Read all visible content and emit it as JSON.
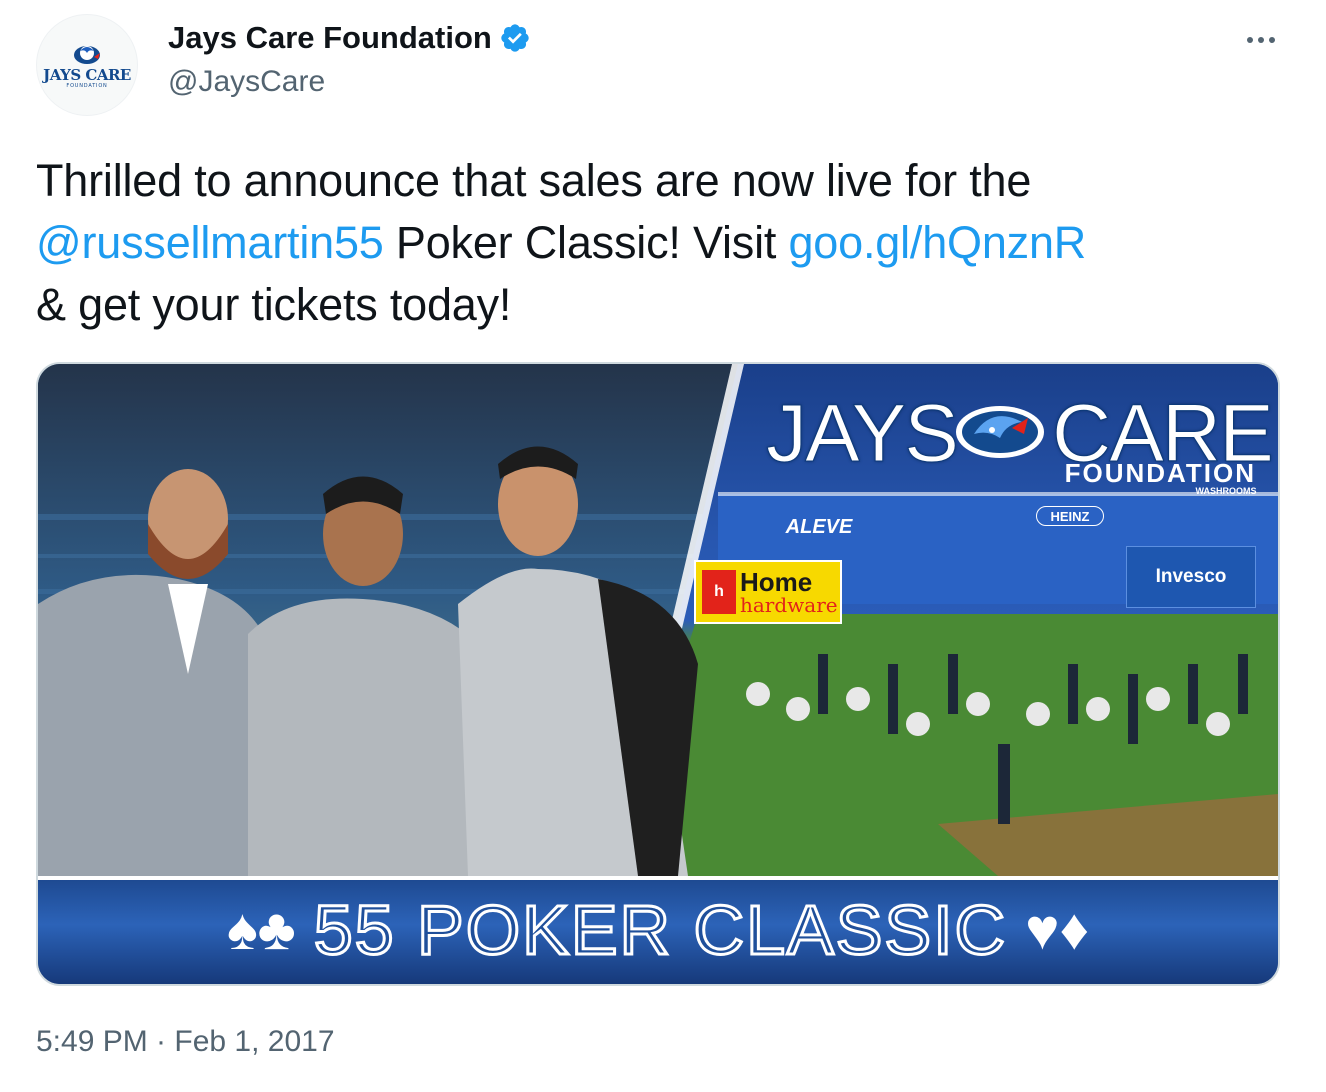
{
  "author": {
    "display_name": "Jays Care Foundation",
    "handle": "@JaysCare",
    "verified": true,
    "avatar": {
      "logo_text": "JAYS CARE",
      "logo_sub": "FOUNDATION",
      "icon": "blue-jay-logo-icon"
    }
  },
  "menu": {
    "icon": "more-options-icon"
  },
  "tweet": {
    "text_part1": "Thrilled to announce that sales are now live for the ",
    "mention": "@russellmartin55",
    "text_part2": " Poker Classic! Visit ",
    "link": "goo.gl/hQnznR",
    "text_part3": " & get your tickets today!"
  },
  "media": {
    "logo_word_left": "JAYS",
    "logo_word_right": "CARE",
    "logo_foundation": "FOUNDATION",
    "banner_text": "55 POKER CLASSIC",
    "suits_left": "♠♣",
    "suits_right": "♥♦",
    "signs": {
      "aleve": "ALEVE",
      "heinz": "HEINZ",
      "washrooms": "WASHROOMS",
      "home_line1": "Home",
      "home_line2": "hardware",
      "invesco": "Invesco"
    }
  },
  "timestamp": "5:49 PM · Feb 1, 2017",
  "colors": {
    "link": "#1d9bf0",
    "text": "#0f1419",
    "secondary": "#536471",
    "verified": "#1d9bf0",
    "brand_blue": "#134a8e"
  }
}
